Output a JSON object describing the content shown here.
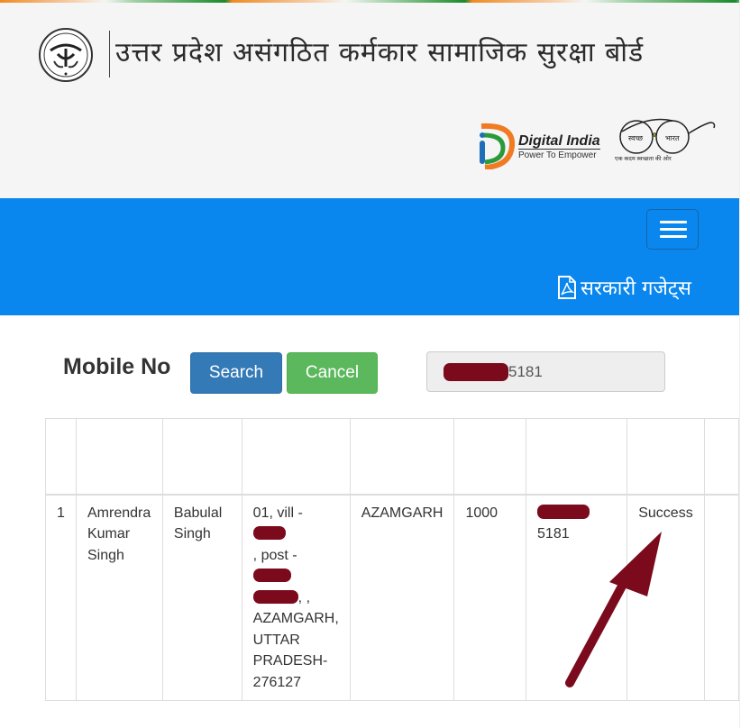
{
  "header": {
    "board_title": "उत्तर प्रदेश असंगठित कर्मकार सामाजिक सुरक्षा बोर्ड",
    "emblem_icon": "up-government-emblem-icon",
    "digital_india": {
      "title": "Digital India",
      "subtitle": "Power To Empower"
    },
    "swachh_bharat": {
      "left_lens": "स्वच्छ",
      "right_lens": "भारत",
      "tagline": "एक कदम स्वच्छता की ओर"
    },
    "tricolor_colors": [
      "#f08a24",
      "#1a8a2a"
    ]
  },
  "navbar": {
    "background": "#0a87ee",
    "menu_toggle_icon": "hamburger-icon",
    "gazette_link": {
      "icon": "pdf-file-icon",
      "label": "सरकारी गजेट्स"
    }
  },
  "search": {
    "label": "Mobile No",
    "search_button": "Search",
    "cancel_button": "Cancel",
    "mobile_value_visible_suffix": "5181",
    "mobile_value_redacted": true
  },
  "table": {
    "header": [
      "",
      "",
      "",
      "",
      "",
      "",
      "",
      "",
      ""
    ],
    "rows": [
      {
        "sno": "1",
        "name": "Amrendra Kumar Singh",
        "father_name": "Babulal Singh",
        "address": {
          "line1": "01, vill -",
          "line2": ", post -",
          "line4_suffix": ", ,",
          "line5": "AZAMGARH, UTTAR PRADESH-276127"
        },
        "district": "AZAMGARH",
        "amount": "1000",
        "mobile_visible_suffix": "5181",
        "status": "Success",
        "extra": ""
      }
    ]
  },
  "annotation": {
    "arrow_color": "#7a0a1c",
    "points_to": "Success"
  },
  "colors": {
    "search_button": "#337ab7",
    "cancel_button": "#5cb85c",
    "redaction": "#7a0a1c"
  }
}
